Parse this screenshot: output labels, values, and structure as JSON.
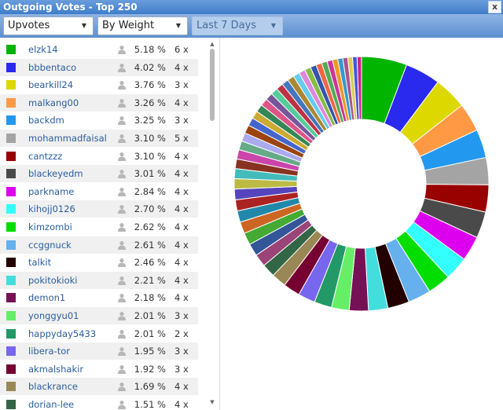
{
  "window": {
    "title": "Outgoing Votes - Top 250",
    "close_label": "x"
  },
  "toolbar": {
    "vote_type": "Upvotes",
    "sort": "By Weight",
    "period": "Last 7 Days"
  },
  "list": [
    {
      "name": "elzk14",
      "pct": "5.18 %",
      "count": "6 x",
      "color": "#00b400"
    },
    {
      "name": "bbbentaco",
      "pct": "4.02 %",
      "count": "4 x",
      "color": "#2a2aee"
    },
    {
      "name": "bearkill24",
      "pct": "3.76 %",
      "count": "3 x",
      "color": "#dcd800"
    },
    {
      "name": "malkang00",
      "pct": "3.26 %",
      "count": "4 x",
      "color": "#ff9944"
    },
    {
      "name": "backdm",
      "pct": "3.25 %",
      "count": "3 x",
      "color": "#2299ee"
    },
    {
      "name": "mohammadfaisal",
      "pct": "3.10 %",
      "count": "5 x",
      "color": "#a4a4a4"
    },
    {
      "name": "cantzzz",
      "pct": "3.10 %",
      "count": "4 x",
      "color": "#990000"
    },
    {
      "name": "blackeyedm",
      "pct": "3.01 %",
      "count": "4 x",
      "color": "#4a4a4a"
    },
    {
      "name": "parkname",
      "pct": "2.84 %",
      "count": "4 x",
      "color": "#dd00ee"
    },
    {
      "name": "kihojj0126",
      "pct": "2.70 %",
      "count": "4 x",
      "color": "#33ffff"
    },
    {
      "name": "kimzombi",
      "pct": "2.62 %",
      "count": "4 x",
      "color": "#00dd00"
    },
    {
      "name": "ccggnuck",
      "pct": "2.61 %",
      "count": "4 x",
      "color": "#66b0ee"
    },
    {
      "name": "talkit",
      "pct": "2.46 %",
      "count": "4 x",
      "color": "#220000"
    },
    {
      "name": "pokitokioki",
      "pct": "2.21 %",
      "count": "4 x",
      "color": "#44dddd"
    },
    {
      "name": "demon1",
      "pct": "2.18 %",
      "count": "4 x",
      "color": "#771155"
    },
    {
      "name": "yonggyu01",
      "pct": "2.01 %",
      "count": "3 x",
      "color": "#66ee66"
    },
    {
      "name": "happyday5433",
      "pct": "2.01 %",
      "count": "2 x",
      "color": "#229966"
    },
    {
      "name": "libera-tor",
      "pct": "1.95 %",
      "count": "3 x",
      "color": "#7766ee"
    },
    {
      "name": "akmalshakir",
      "pct": "1.92 %",
      "count": "3 x",
      "color": "#770033"
    },
    {
      "name": "blackrance",
      "pct": "1.69 %",
      "count": "4 x",
      "color": "#998855"
    },
    {
      "name": "dorian-lee",
      "pct": "1.51 %",
      "count": "4 x",
      "color": "#336644"
    }
  ],
  "chart_data": {
    "type": "pie",
    "donut": true,
    "categories": [
      "elzk14",
      "bbbentaco",
      "bearkill24",
      "malkang00",
      "backdm",
      "mohammadfaisal",
      "cantzzz",
      "blackeyedm",
      "parkname",
      "kihojj0126",
      "kimzombi",
      "ccggnuck",
      "talkit",
      "pokitokioki",
      "demon1",
      "yonggyu01",
      "happyday5433",
      "libera-tor",
      "akmalshakir",
      "blackrance",
      "dorian-lee"
    ],
    "values": [
      5.18,
      4.02,
      3.76,
      3.26,
      3.25,
      3.1,
      3.1,
      3.01,
      2.84,
      2.7,
      2.62,
      2.61,
      2.46,
      2.21,
      2.18,
      2.01,
      2.01,
      1.95,
      1.92,
      1.69,
      1.51
    ],
    "colors": [
      "#00b400",
      "#2a2aee",
      "#dcd800",
      "#ff9944",
      "#2299ee",
      "#a4a4a4",
      "#990000",
      "#4a4a4a",
      "#dd00ee",
      "#33ffff",
      "#00dd00",
      "#66b0ee",
      "#220000",
      "#44dddd",
      "#771155",
      "#66ee66",
      "#229966",
      "#7766ee",
      "#770033",
      "#998855",
      "#336644"
    ],
    "other_slices": {
      "values": [
        1.45,
        1.42,
        1.38,
        1.34,
        1.3,
        1.26,
        1.22,
        1.18,
        1.14,
        1.1,
        1.06,
        1.02,
        0.98,
        0.95,
        0.92,
        0.9,
        0.88,
        0.86,
        0.84,
        0.82,
        0.8,
        0.78,
        0.76,
        0.74,
        0.72,
        0.7,
        0.68,
        0.66,
        0.64,
        0.62,
        0.6,
        0.58,
        0.56,
        0.54,
        0.52,
        0.5
      ],
      "colors": [
        "#9a4477",
        "#335599",
        "#44aa33",
        "#cc6622",
        "#2288aa",
        "#aa2222",
        "#5544bb",
        "#bbbb44",
        "#44bbbb",
        "#883322",
        "#cc44aa",
        "#66aa88",
        "#aaaaee",
        "#994411",
        "#4466cc",
        "#ccaa33",
        "#338855",
        "#dd5588",
        "#775599",
        "#55cc99",
        "#bb3344",
        "#4477bb",
        "#aa8833",
        "#66ccee",
        "#dd88dd",
        "#88bb44",
        "#3355aa",
        "#ee6644",
        "#55aa55",
        "#cc3399",
        "#ee9922",
        "#3399cc",
        "#aa5588",
        "#ddcc55",
        "#4455dd",
        "#cc2288"
      ]
    }
  }
}
